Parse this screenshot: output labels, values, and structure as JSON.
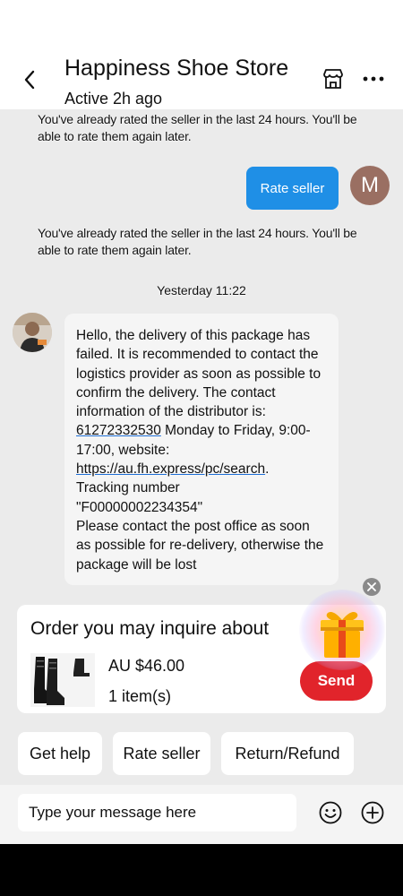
{
  "header": {
    "title": "Happiness Shoe Store",
    "status": "Active 2h ago",
    "icons": [
      "back-arrow-icon",
      "store-icon",
      "more-icon"
    ]
  },
  "messages": {
    "system_1": "You've already rated the seller in the last 24 hours. You'll be able to rate them again later.",
    "rate_bubble": "Rate seller",
    "user_avatar_letter": "M",
    "system_2": "You've already rated the seller in the last 24 hours. You'll be able to rate them again later.",
    "timestamp": "Yesterday 11:22",
    "seller_message": {
      "intro": "Hello, the delivery of this package has failed. It is recommended to contact the logistics provider as soon as possible to confirm the delivery. The contact information of the distributor is: ",
      "phone": "61272332530",
      "hours": " Monday to Friday, 9:00-17:00, website: ",
      "url": "https://au.fh.express/pc/search",
      "after_url": ".",
      "tracking_label": "Tracking number",
      "tracking_number": "\"F00000002234354\"",
      "outro": "Please contact the post office as soon as possible for re-delivery, otherwise the package will be lost"
    }
  },
  "order_card": {
    "title": "Order you may inquire about",
    "price": "AU $46.00",
    "items": "1 item(s)",
    "send_label": "Send"
  },
  "quick_actions": [
    "Get help",
    "Rate seller",
    "Return/Refund"
  ],
  "composer": {
    "placeholder": "Type your message here"
  },
  "colors": {
    "accent_blue": "#1f8fe6",
    "send_red": "#e1242b",
    "user_avatar": "#9a6f62",
    "background": "#ebebeb"
  }
}
